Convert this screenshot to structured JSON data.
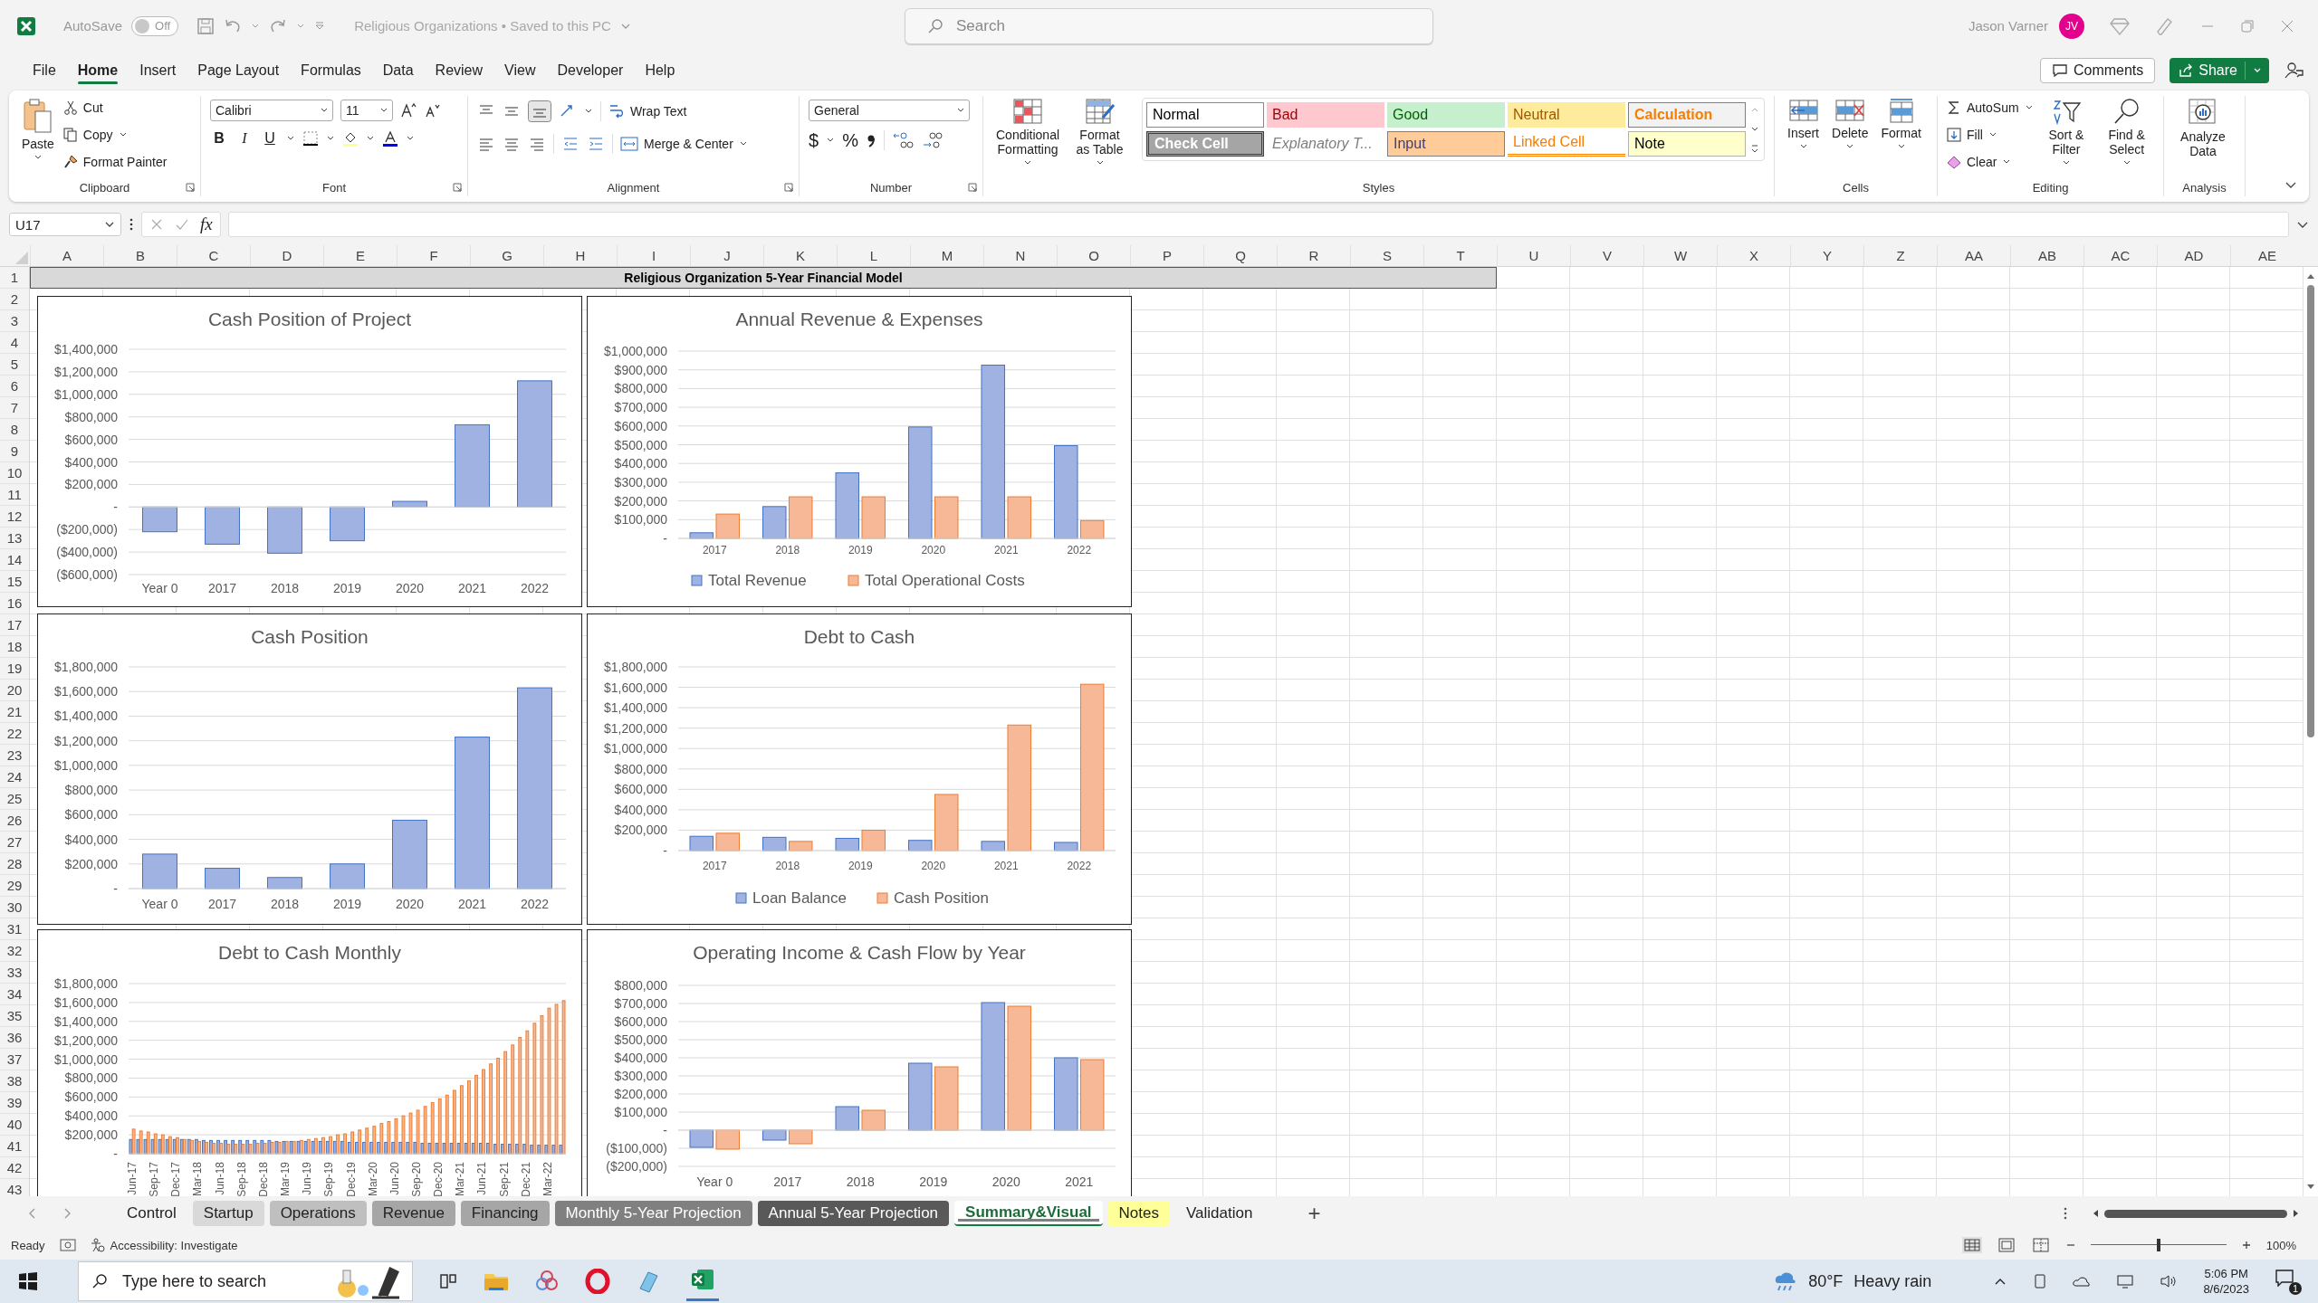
{
  "title_bar": {
    "autosave": {
      "label": "AutoSave",
      "state": "Off",
      "on": false
    },
    "document": "Religious Organizations • Saved to this PC",
    "search": {
      "placeholder": "Search"
    },
    "user": "Jason Varner",
    "avatar": "JV"
  },
  "menu": {
    "tabs": [
      {
        "label": "File",
        "selected": false
      },
      {
        "label": "Home",
        "selected": true
      },
      {
        "label": "Insert",
        "selected": false
      },
      {
        "label": "Page Layout",
        "selected": false
      },
      {
        "label": "Formulas",
        "selected": false
      },
      {
        "label": "Data",
        "selected": false
      },
      {
        "label": "Review",
        "selected": false
      },
      {
        "label": "View",
        "selected": false
      },
      {
        "label": "Developer",
        "selected": false
      },
      {
        "label": "Help",
        "selected": false
      }
    ],
    "comments": "Comments",
    "share": "Share"
  },
  "ribbon": {
    "clipboard": {
      "label": "Clipboard",
      "paste": "Paste",
      "items": [
        "Cut",
        "Copy",
        "Format Painter"
      ]
    },
    "font": {
      "label": "Font",
      "font": "Calibri",
      "size": "11",
      "styles": [
        "B",
        "I",
        "U"
      ]
    },
    "alignment": {
      "label": "Alignment",
      "wrap": "Wrap Text",
      "merge": "Merge & Center"
    },
    "number": {
      "label": "Number",
      "format": "General",
      "symbols": [
        "$",
        "%"
      ]
    },
    "styles": {
      "label": "Styles",
      "buttons": [
        "Conditional Formatting",
        "Format as Table"
      ],
      "cells": [
        {
          "label": "Normal",
          "kind": "normal"
        },
        {
          "label": "Bad",
          "kind": "bad"
        },
        {
          "label": "Good",
          "kind": "good"
        },
        {
          "label": "Neutral",
          "kind": "neutral"
        },
        {
          "label": "Calculation",
          "kind": "calculation"
        },
        {
          "label": "Check Cell",
          "kind": "check"
        },
        {
          "label": "Explanatory T...",
          "kind": "explanatory"
        },
        {
          "label": "Input",
          "kind": "input"
        },
        {
          "label": "Linked Cell",
          "kind": "linked"
        },
        {
          "label": "Note",
          "kind": "note"
        }
      ]
    },
    "cells": {
      "label": "Cells",
      "buttons": [
        "Insert",
        "Delete",
        "Format"
      ]
    },
    "editing": {
      "label": "Editing",
      "items": [
        "AutoSum",
        "Fill",
        "Clear"
      ],
      "buttons": [
        "Sort & Filter",
        "Find & Select"
      ]
    },
    "analysis": {
      "label": "Analysis",
      "buttons": [
        "Analyze Data"
      ]
    }
  },
  "formula_bar": {
    "name_box": "U17",
    "fx": "fx"
  },
  "columns": [
    "A",
    "B",
    "C",
    "D",
    "E",
    "F",
    "G",
    "H",
    "I",
    "J",
    "K",
    "L",
    "M",
    "N",
    "O",
    "P",
    "Q",
    "R",
    "S",
    "T",
    "U",
    "V",
    "W",
    "X",
    "Y",
    "Z",
    "AA",
    "AB",
    "AC",
    "AD",
    "AE"
  ],
  "rows": [
    "1",
    "2",
    "3",
    "4",
    "5",
    "6",
    "7",
    "8",
    "9",
    "10",
    "11",
    "12",
    "13",
    "14",
    "15",
    "16",
    "17",
    "18",
    "19",
    "20",
    "21",
    "22",
    "23",
    "24",
    "25",
    "26",
    "27",
    "28",
    "29",
    "30",
    "31",
    "32",
    "33",
    "34",
    "35",
    "36",
    "37",
    "38",
    "39",
    "40",
    "41",
    "42",
    "43"
  ],
  "sheet_title": "Religious Organization 5-Year Financial Model",
  "charts": [
    {
      "chart_data": {
        "type": "bar",
        "grid": true,
        "title": "Cash Position of Project",
        "categories": [
          "Year 0",
          "2017",
          "2018",
          "2019",
          "2020",
          "2021",
          "2022"
        ],
        "series": [
          {
            "color": "#9fb2e2",
            "values": [
              -220000,
              -330000,
              -410000,
              -300000,
              50000,
              730000,
              1120000
            ]
          }
        ],
        "ylim": [
          -600000,
          1400000
        ],
        "yticks": [
          {
            "value": 1400000,
            "label": "$1,400,000"
          },
          {
            "value": 1200000,
            "label": "$1,200,000"
          },
          {
            "value": 1000000,
            "label": "$1,000,000"
          },
          {
            "value": 800000,
            "label": "$800,000"
          },
          {
            "value": 600000,
            "label": "$600,000"
          },
          {
            "value": 400000,
            "label": "$400,000"
          },
          {
            "value": 200000,
            "label": "$200,000"
          },
          {
            "value": 0,
            "label": "-"
          },
          {
            "value": -200000,
            "label": "($200,000)"
          },
          {
            "value": -400000,
            "label": "($400,000)"
          },
          {
            "value": -600000,
            "label": "($600,000)"
          }
        ]
      }
    },
    {
      "chart_data": {
        "type": "bar",
        "grid": true,
        "legend": "bottom",
        "title": "Annual Revenue & Expenses",
        "categories": [
          "2017",
          "2018",
          "2019",
          "2020",
          "2021",
          "2022"
        ],
        "series": [
          {
            "name": "Total Revenue",
            "color": "#9fb2e2",
            "values": [
              30000,
              170000,
              350000,
              595000,
              925000,
              495000
            ]
          },
          {
            "name": "Total Operational Costs",
            "color": "#f6b896",
            "values": [
              130000,
              222000,
              222000,
              222000,
              222000,
              95000
            ]
          }
        ],
        "ylim": [
          0,
          1000000
        ],
        "yticks": [
          {
            "value": 1000000,
            "label": "$1,000,000"
          },
          {
            "value": 900000,
            "label": "$900,000"
          },
          {
            "value": 800000,
            "label": "$800,000"
          },
          {
            "value": 700000,
            "label": "$700,000"
          },
          {
            "value": 600000,
            "label": "$600,000"
          },
          {
            "value": 500000,
            "label": "$500,000"
          },
          {
            "value": 400000,
            "label": "$400,000"
          },
          {
            "value": 300000,
            "label": "$300,000"
          },
          {
            "value": 200000,
            "label": "$200,000"
          },
          {
            "value": 100000,
            "label": "$100,000"
          },
          {
            "value": 0,
            "label": "-"
          }
        ]
      }
    },
    {
      "chart_data": {
        "type": "bar",
        "grid": true,
        "title": "Cash Position",
        "categories": [
          "Year 0",
          "2017",
          "2018",
          "2019",
          "2020",
          "2021",
          "2022"
        ],
        "series": [
          {
            "color": "#9fb2e2",
            "values": [
              280000,
              165000,
              90000,
              200000,
              555000,
              1230000,
              1630000
            ]
          }
        ],
        "ylim": [
          0,
          1800000
        ],
        "yticks": [
          {
            "value": 1800000,
            "label": "$1,800,000"
          },
          {
            "value": 1600000,
            "label": "$1,600,000"
          },
          {
            "value": 1400000,
            "label": "$1,400,000"
          },
          {
            "value": 1200000,
            "label": "$1,200,000"
          },
          {
            "value": 1000000,
            "label": "$1,000,000"
          },
          {
            "value": 800000,
            "label": "$800,000"
          },
          {
            "value": 600000,
            "label": "$600,000"
          },
          {
            "value": 400000,
            "label": "$400,000"
          },
          {
            "value": 200000,
            "label": "$200,000"
          },
          {
            "value": 0,
            "label": "-"
          }
        ]
      }
    },
    {
      "chart_data": {
        "type": "bar",
        "grid": true,
        "legend": "bottom",
        "title": "Debt to Cash",
        "categories": [
          "2017",
          "2018",
          "2019",
          "2020",
          "2021",
          "2022"
        ],
        "series": [
          {
            "name": "Loan Balance",
            "color": "#9fb2e2",
            "values": [
              140000,
              130000,
              120000,
              100000,
              90000,
              80000
            ]
          },
          {
            "name": "Cash Position",
            "color": "#f6b896",
            "values": [
              170000,
              90000,
              200000,
              550000,
              1230000,
              1630000
            ]
          }
        ],
        "ylim": [
          0,
          1800000
        ],
        "yticks": [
          {
            "value": 1800000,
            "label": "$1,800,000"
          },
          {
            "value": 1600000,
            "label": "$1,600,000"
          },
          {
            "value": 1400000,
            "label": "$1,400,000"
          },
          {
            "value": 1200000,
            "label": "$1,200,000"
          },
          {
            "value": 1000000,
            "label": "$1,000,000"
          },
          {
            "value": 800000,
            "label": "$800,000"
          },
          {
            "value": 600000,
            "label": "$600,000"
          },
          {
            "value": 400000,
            "label": "$400,000"
          },
          {
            "value": 200000,
            "label": "$200,000"
          },
          {
            "value": 0,
            "label": "-"
          }
        ]
      }
    },
    {
      "chart_data": {
        "type": "bar",
        "grid": true,
        "title": "Debt to Cash Monthly",
        "categories": [
          "Jun-17",
          null,
          null,
          "Sep-17",
          null,
          null,
          "Dec-17",
          null,
          null,
          "Mar-18",
          null,
          null,
          "Jun-18",
          null,
          null,
          "Sep-18",
          null,
          null,
          "Dec-18",
          null,
          null,
          "Mar-19",
          null,
          null,
          "Jun-19",
          null,
          null,
          "Sep-19",
          null,
          null,
          "Dec-19",
          null,
          null,
          "Mar-20",
          null,
          null,
          "Jun-20",
          null,
          null,
          "Sep-20",
          null,
          null,
          "Dec-20",
          null,
          null,
          "Mar-21",
          null,
          null,
          "Jun-21",
          null,
          null,
          "Sep-21",
          null,
          null,
          "Dec-21",
          null,
          null,
          "Mar-22",
          null,
          null
        ],
        "series": [
          {
            "color": "#9fb2e2",
            "values": [
              150000,
              150000,
              150000,
              150000,
              150000,
              150000,
              150000,
              150000,
              150000,
              150000,
              140000,
              140000,
              140000,
              140000,
              140000,
              140000,
              140000,
              140000,
              140000,
              140000,
              130000,
              130000,
              130000,
              130000,
              130000,
              130000,
              130000,
              130000,
              130000,
              130000,
              120000,
              120000,
              120000,
              120000,
              120000,
              120000,
              120000,
              120000,
              120000,
              120000,
              110000,
              110000,
              110000,
              110000,
              110000,
              110000,
              110000,
              110000,
              110000,
              110000,
              100000,
              100000,
              100000,
              100000,
              100000,
              90000,
              90000,
              90000,
              90000,
              90000
            ]
          },
          {
            "color": "#f6b896",
            "values": [
              260000,
              240000,
              230000,
              210000,
              200000,
              180000,
              170000,
              150000,
              140000,
              130000,
              120000,
              110000,
              110000,
              100000,
              100000,
              100000,
              100000,
              110000,
              110000,
              120000,
              120000,
              130000,
              130000,
              140000,
              150000,
              160000,
              170000,
              180000,
              200000,
              210000,
              230000,
              250000,
              270000,
              290000,
              320000,
              340000,
              370000,
              400000,
              430000,
              460000,
              500000,
              540000,
              580000,
              620000,
              670000,
              720000,
              770000,
              830000,
              890000,
              950000,
              1010000,
              1080000,
              1150000,
              1230000,
              1300000,
              1380000,
              1460000,
              1540000,
              1580000,
              1620000
            ]
          }
        ],
        "ylim": [
          0,
          1800000
        ],
        "yticks": [
          {
            "value": 1800000,
            "label": "$1,800,000"
          },
          {
            "value": 1600000,
            "label": "$1,600,000"
          },
          {
            "value": 1400000,
            "label": "$1,400,000"
          },
          {
            "value": 1200000,
            "label": "$1,200,000"
          },
          {
            "value": 1000000,
            "label": "$1,000,000"
          },
          {
            "value": 800000,
            "label": "$800,000"
          },
          {
            "value": 600000,
            "label": "$600,000"
          },
          {
            "value": 400000,
            "label": "$400,000"
          },
          {
            "value": 200000,
            "label": "$200,000"
          },
          {
            "value": 0,
            "label": "-"
          }
        ]
      }
    },
    {
      "chart_data": {
        "type": "bar",
        "grid": true,
        "title": "Operating Income & Cash Flow by Year",
        "categories": [
          "Year 0",
          "2017",
          "2018",
          "2019",
          "2020",
          "2021"
        ],
        "series": [
          {
            "color": "#9fb2e2",
            "values": [
              -95000,
              -55000,
              130000,
              370000,
              705000,
              400000
            ]
          },
          {
            "color": "#f6b896",
            "values": [
              -105000,
              -75000,
              110000,
              350000,
              685000,
              390000
            ]
          }
        ],
        "ylim": [
          -200000,
          800000
        ],
        "yticks": [
          {
            "value": 800000,
            "label": "$800,000"
          },
          {
            "value": 700000,
            "label": "$700,000"
          },
          {
            "value": 600000,
            "label": "$600,000"
          },
          {
            "value": 500000,
            "label": "$500,000"
          },
          {
            "value": 400000,
            "label": "$400,000"
          },
          {
            "value": 300000,
            "label": "$300,000"
          },
          {
            "value": 200000,
            "label": "$200,000"
          },
          {
            "value": 100000,
            "label": "$100,000"
          },
          {
            "value": 0,
            "label": "-"
          },
          {
            "value": -100000,
            "label": "($100,000)"
          },
          {
            "value": -200000,
            "label": "($200,000)"
          }
        ]
      }
    }
  ],
  "sheet_tabs": [
    {
      "label": "Control",
      "selected": false
    },
    {
      "label": "Startup",
      "selected": false,
      "color": "#d9d9d9"
    },
    {
      "label": "Operations",
      "selected": false,
      "color": "#bfbfbf"
    },
    {
      "label": "Revenue",
      "selected": false,
      "color": "#a6a6a6"
    },
    {
      "label": "Financing",
      "selected": false,
      "color": "#a6a6a6"
    },
    {
      "label": "Monthly 5-Year Projection",
      "selected": false,
      "color": "#808080"
    },
    {
      "label": "Annual 5-Year Projection",
      "selected": false,
      "color": "#595959"
    },
    {
      "label": "Summary&Visual",
      "selected": true,
      "color": "#808080"
    },
    {
      "label": "Notes",
      "selected": false,
      "color": "#ffff99"
    },
    {
      "label": "Validation",
      "selected": false
    }
  ],
  "add_sheet": "+",
  "status_bar": {
    "mode": "Ready",
    "accessibility": "Accessibility: Investigate",
    "zoom": {
      "level": 0.5,
      "reading": "100%"
    }
  },
  "taskbar": {
    "search": {
      "placeholder": "Type here to search"
    },
    "weather": {
      "temperature": "80°F",
      "condition": "Heavy rain"
    },
    "time": "5:06 PM",
    "date": "8/6/2023",
    "notifications": "1"
  }
}
